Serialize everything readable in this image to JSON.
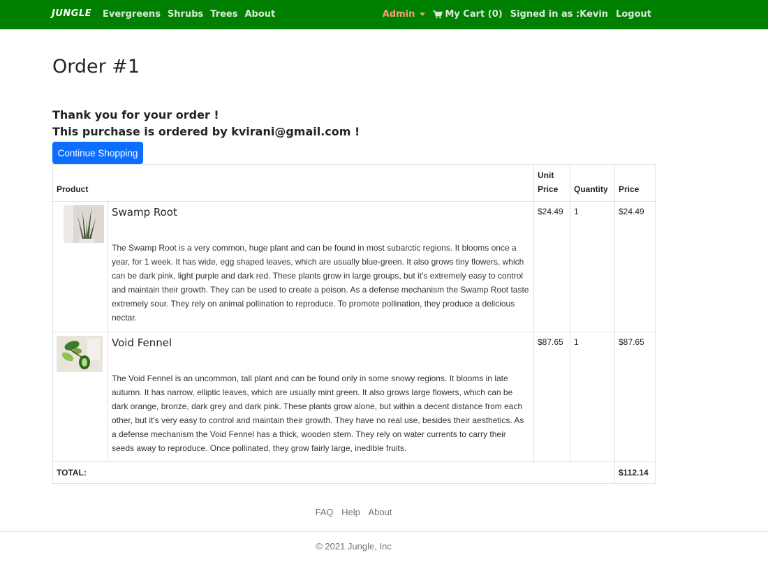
{
  "nav": {
    "brand": "JUNGLE",
    "links": [
      "Evergreens",
      "Shrubs",
      "Trees",
      "About"
    ],
    "admin": "Admin",
    "cart": "My Cart (0)",
    "signed_in": "Signed in as :Kevin",
    "logout": "Logout"
  },
  "page": {
    "title": "Order #1",
    "thanks_line1": "Thank you for your order !",
    "thanks_line2": "This purchase is ordered by kvirani@gmail.com !",
    "continue_label": "Continue Shopping"
  },
  "table": {
    "headers": {
      "product": "Product",
      "unit_price_1": "Unit",
      "unit_price_2": "Price",
      "quantity": "Quantity",
      "price": "Price"
    },
    "rows": [
      {
        "name": "Swamp Root",
        "description": "The Swamp Root is a very common, huge plant and can be found in most subarctic regions. It blooms once a year, for 1 week. It has wide, egg shaped leaves, which are usually blue-green. It also grows tiny flowers, which can be dark pink, light purple and dark red. These plants grow in large groups, but it's extremely easy to control and maintain their growth. They can be used to create a poison. As a defense mechanism the Swamp Root taste extremely sour. They rely on animal pollination to reproduce. To promote pollination, they produce a delicious nectar.",
        "unit_price": "$24.49",
        "quantity": "1",
        "price": "$24.49"
      },
      {
        "name": "Void Fennel",
        "description": "The Void Fennel is an uncommon, tall plant and can be found only in some snowy regions. It blooms in late autumn. It has narrow, elliptic leaves, which are usually mint green. It also grows large flowers, which can be dark orange, bronze, dark grey and dark pink. These plants grow alone, but within a decent distance from each other, but it's very easy to control and maintain their growth. They have no real use, besides their aesthetics. As a defense mechanism the Void Fennel has a thick, wooden stem. They rely on water currents to carry their seeds away to reproduce. Once pollinated, they grow fairly large, inedible fruits.",
        "unit_price": "$87.65",
        "quantity": "1",
        "price": "$87.65"
      }
    ],
    "total_label": "TOTAL:",
    "total_value": "$112.14"
  },
  "footer": {
    "links": [
      "FAQ",
      "Help",
      "About"
    ],
    "copyright": "© 2021 Jungle, Inc"
  },
  "colors": {
    "navbar": "#008000",
    "admin": "#f4a07a",
    "button": "#0d6efd"
  },
  "icons": {
    "cart": "shopping-cart-icon",
    "admin_dropdown": "caret-down-icon"
  }
}
